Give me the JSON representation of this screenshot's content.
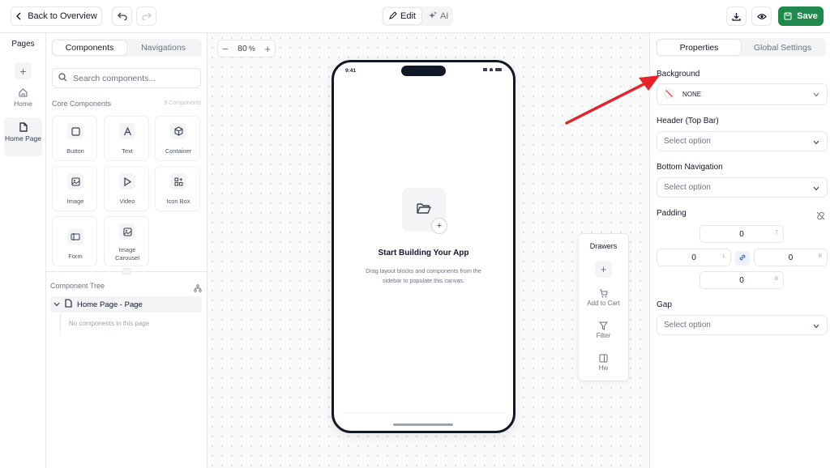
{
  "topbar": {
    "back_label": "Back to Overview",
    "mode_edit": "Edit",
    "mode_ai": "AI",
    "save_label": "Save"
  },
  "pages": {
    "title": "Pages",
    "items": [
      {
        "label": "Home",
        "icon": "home-icon"
      },
      {
        "label": "Home Page",
        "icon": "file-icon",
        "active": true
      }
    ]
  },
  "components_panel": {
    "tabs": [
      "Components",
      "Navigations"
    ],
    "active_tab": "Components",
    "search_placeholder": "Search components...",
    "section_title": "Core Components",
    "section_count": "8 Components",
    "tiles": [
      {
        "label": "Button",
        "icon": "square-icon"
      },
      {
        "label": "Text",
        "icon": "text-icon"
      },
      {
        "label": "Container",
        "icon": "box-icon"
      },
      {
        "label": "Image",
        "icon": "image-icon"
      },
      {
        "label": "Video",
        "icon": "play-icon"
      },
      {
        "label": "Icon Box",
        "icon": "grid-plus-icon"
      },
      {
        "label": "Form",
        "icon": "form-icon"
      },
      {
        "label": "Image Carousel",
        "icon": "carousel-icon"
      }
    ],
    "tree_title": "Component Tree",
    "tree_root": "Home Page - Page",
    "tree_empty": "No components in this page"
  },
  "canvas": {
    "zoom_value": "80",
    "zoom_unit": "%",
    "phone_time": "9:41",
    "empty_title": "Start Building Your App",
    "empty_desc": "Drag layout blocks and components from the sidebar to populate this canvas."
  },
  "drawers": {
    "title": "Drawers",
    "items": [
      {
        "label": "Add to Cart",
        "icon": "cart-icon"
      },
      {
        "label": "Filter",
        "icon": "filter-icon"
      },
      {
        "label": "Hw",
        "icon": "panel-icon"
      }
    ]
  },
  "properties": {
    "tabs": [
      "Properties",
      "Global Settings"
    ],
    "active_tab": "Properties",
    "background_label": "Background",
    "background_value": "NONE",
    "header_label": "Header (Top Bar)",
    "header_value": "Select option",
    "bottomnav_label": "Bottom Navigation",
    "bottomnav_value": "Select option",
    "padding_label": "Padding",
    "padding": {
      "top": "0",
      "left": "0",
      "right": "0",
      "bottom": "0"
    },
    "padding_suffix": {
      "top": "T",
      "left": "L",
      "right": "R",
      "bottom": "B"
    },
    "gap_label": "Gap",
    "gap_value": "Select option"
  },
  "colors": {
    "accent_green": "#1f8a4c",
    "annotation_arrow": "#e5242a"
  }
}
